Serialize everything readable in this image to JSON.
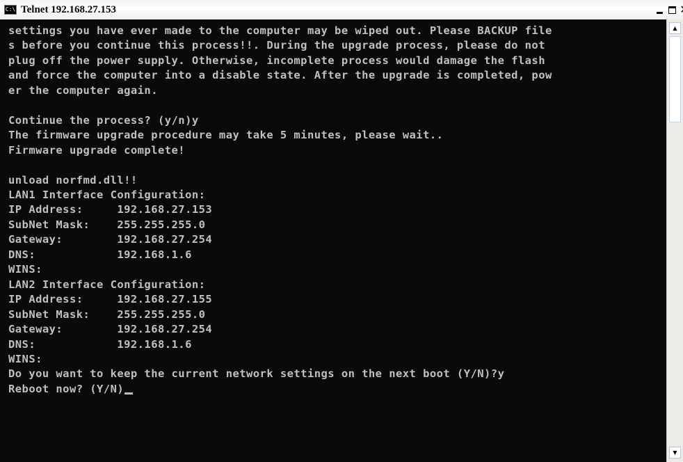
{
  "window": {
    "title": "Telnet 192.168.27.153",
    "icon_label": "C:\\",
    "buttons": {
      "minimize": "minimize-icon",
      "maximize": "maximize-icon",
      "close": "close-icon"
    }
  },
  "console": {
    "lines": [
      "settings you have ever made to the computer may be wiped out. Please BACKUP file",
      "s before you continue this process!!. During the upgrade process, please do not",
      "plug off the power supply. Otherwise, incomplete process would damage the flash",
      "and force the computer into a disable state. After the upgrade is completed, pow",
      "er the computer again.",
      "",
      "Continue the process? (y/n)y",
      "The firmware upgrade procedure may take 5 minutes, please wait..",
      "Firmware upgrade complete!",
      "",
      "unload norfmd.dll!!",
      "LAN1 Interface Configuration:",
      "IP Address:     192.168.27.153",
      "SubNet Mask:    255.255.255.0",
      "Gateway:        192.168.27.254",
      "DNS:            192.168.1.6",
      "WINS:",
      "LAN2 Interface Configuration:",
      "IP Address:     192.168.27.155",
      "SubNet Mask:    255.255.255.0",
      "Gateway:        192.168.27.254",
      "DNS:            192.168.1.6",
      "WINS:",
      "Do you want to keep the current network settings on the next boot (Y/N)?y",
      "Reboot now? (Y/N)"
    ]
  },
  "scrollbar": {
    "up": "scroll-up-arrow-icon",
    "down": "scroll-down-arrow-icon"
  },
  "colors": {
    "background": "#0a0a0a",
    "text": "#c0c0c0"
  }
}
